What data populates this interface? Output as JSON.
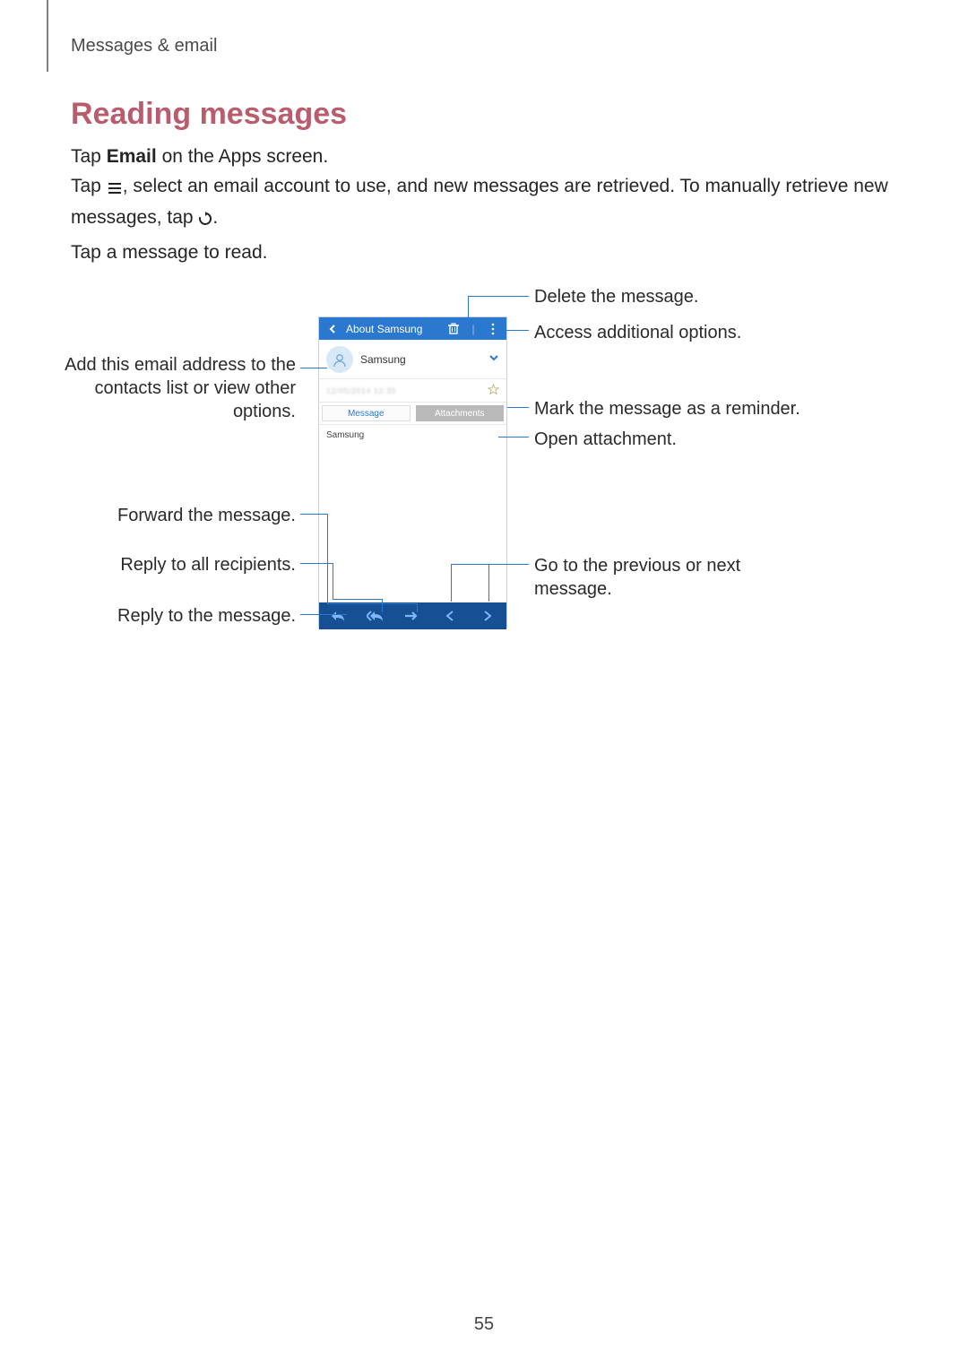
{
  "page": {
    "running_head": "Messages & email",
    "number": "55"
  },
  "section": {
    "heading": "Reading messages",
    "p1_pre": "Tap ",
    "p1_bold": "Email",
    "p1_post": " on the Apps screen.",
    "p2_pre": "Tap ",
    "p2_mid": ", select an email account to use, and new messages are retrieved. To manually retrieve new messages, tap ",
    "p2_post": ".",
    "p3": "Tap a message to read."
  },
  "phone": {
    "topbar_title": "About Samsung",
    "sender": "Samsung",
    "timestamp_blurred": "12/05/2014 12:35",
    "tab_message": "Message",
    "tab_attachments": "Attachments",
    "body": "Samsung"
  },
  "callouts": {
    "delete": "Delete the message.",
    "more": "Access additional options.",
    "contact": "Add this email address to the contacts list or view other options.",
    "star": "Mark the message as a reminder.",
    "attachment": "Open attachment.",
    "forward": "Forward the message.",
    "replyall": "Reply to all recipients.",
    "reply": "Reply to the message.",
    "prevnext": "Go to the previous or next message."
  }
}
